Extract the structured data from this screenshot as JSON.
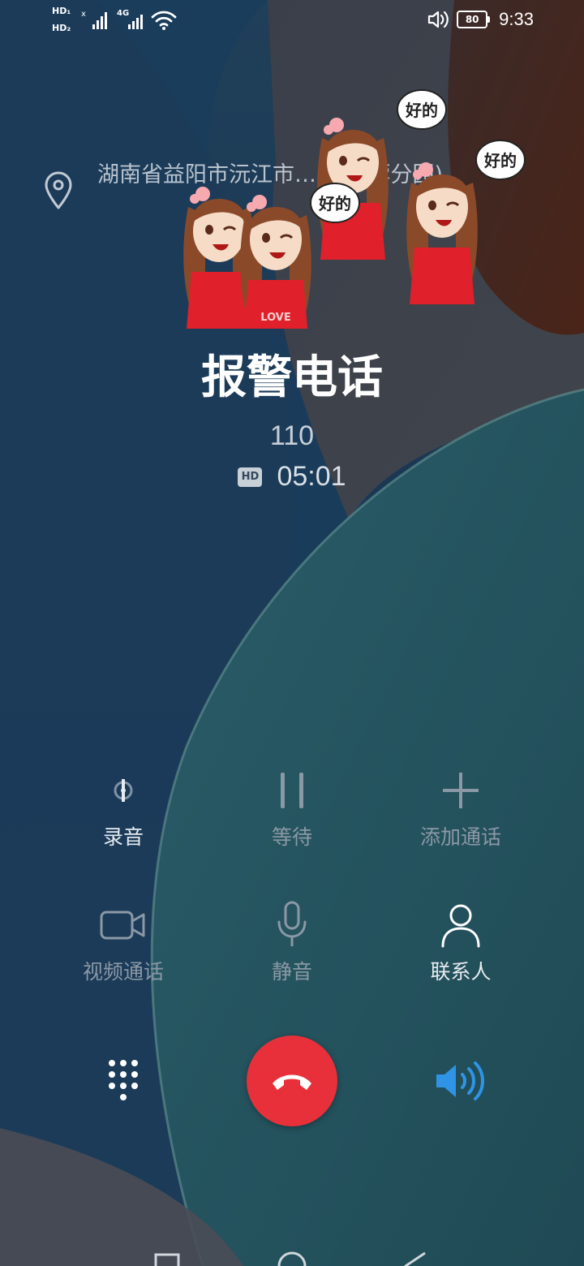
{
  "status_bar": {
    "sim1": "HD₁",
    "sim2": "HD₂",
    "network": "4G",
    "battery": "80",
    "time": "9:33"
  },
  "location": {
    "text": "湖南省益阳市沅江市…心(芙蓉分园)"
  },
  "stickers": {
    "speech_text": "好的",
    "shirt_text": "LOVE"
  },
  "caller": {
    "name": "报警电话",
    "number": "110",
    "hd_badge": "HD",
    "duration": "05:01"
  },
  "controls": [
    {
      "label": "录音"
    },
    {
      "label": "等待"
    },
    {
      "label": "添加通话"
    },
    {
      "label": "视频通话"
    },
    {
      "label": "静音"
    },
    {
      "label": "联系人"
    }
  ],
  "colors": {
    "end_call": "#e8303a",
    "speaker_active": "#2f93e6"
  }
}
